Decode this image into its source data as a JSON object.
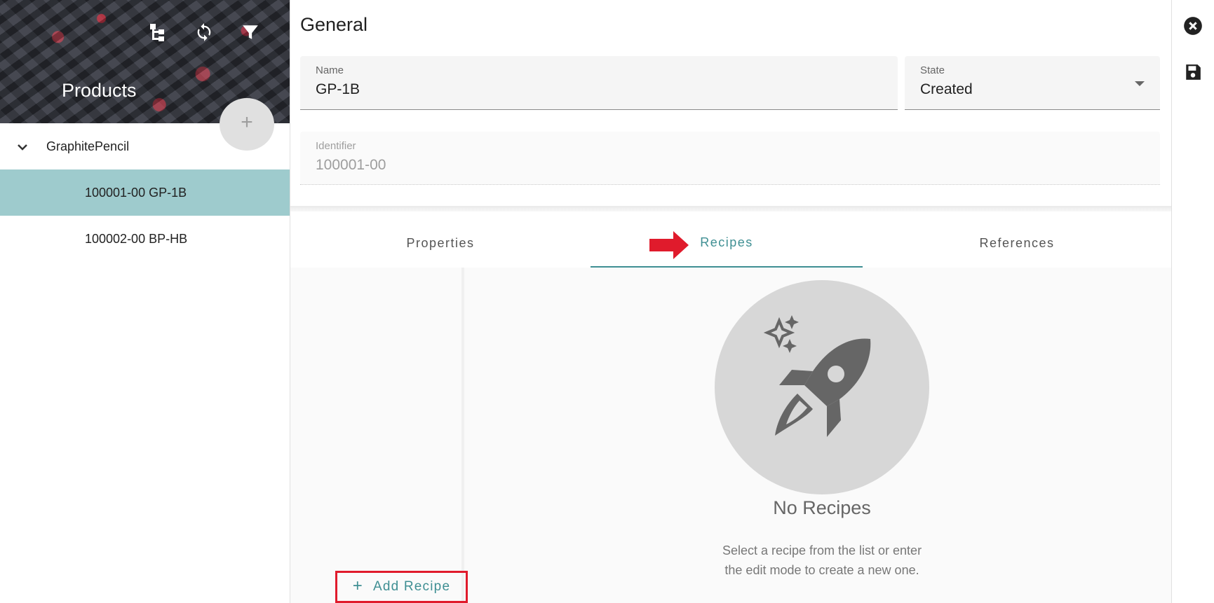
{
  "sidebar": {
    "title": "Products",
    "header_icons": [
      "hierarchy-icon",
      "refresh-icon",
      "filter-icon"
    ],
    "add_button_label": "+",
    "group": {
      "label": "GraphitePencil",
      "expanded": true
    },
    "items": [
      {
        "label": "100001-00 GP-1B",
        "selected": true
      },
      {
        "label": "100002-00 BP-HB",
        "selected": false
      }
    ]
  },
  "general": {
    "title": "General",
    "name": {
      "label": "Name",
      "value": "GP-1B"
    },
    "state": {
      "label": "State",
      "value": "Created"
    },
    "identifier": {
      "label": "Identifier",
      "value": "100001-00"
    }
  },
  "tabs": [
    {
      "label": "Properties",
      "active": false
    },
    {
      "label": "Recipes",
      "active": true
    },
    {
      "label": "References",
      "active": false
    }
  ],
  "recipes": {
    "add_label": "Add Recipe",
    "empty_title": "No Recipes",
    "empty_text": "Select a recipe from the list or enter the edit mode to create a new one."
  },
  "rail": {
    "icons": [
      "close-icon",
      "save-icon"
    ]
  },
  "colors": {
    "accent": "#3f8f93",
    "selected_row": "#9ecbcd",
    "highlight_red": "#e01b2c"
  }
}
